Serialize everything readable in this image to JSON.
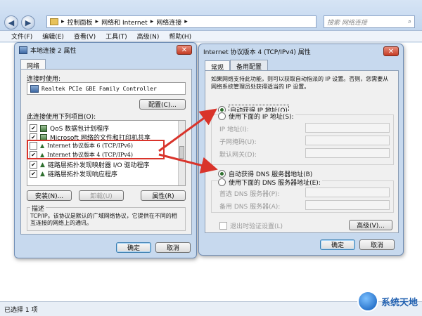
{
  "explorer": {
    "breadcrumb": [
      "控制面板",
      "网络和 Internet",
      "网络连接"
    ],
    "search_placeholder": "搜索 网络连接",
    "menu": [
      "文件(F)",
      "编辑(E)",
      "查看(V)",
      "工具(T)",
      "高级(N)",
      "帮助(H)"
    ],
    "status": "已选择 1 项"
  },
  "props": {
    "title": "本地连接 2 属性",
    "tab": "网络",
    "connect_using_label": "连接时使用:",
    "adapter": "Realtek PCIe GBE Family Controller",
    "configure": "配置(C)...",
    "items_label": "此连接使用下列项目(O):",
    "items": [
      {
        "label": "QoS 数据包计划程序",
        "checked": true
      },
      {
        "label": "Microsoft 网络的文件和打印机共享",
        "checked": true
      },
      {
        "label": "Internet 协议版本 6 (TCP/IPv6)",
        "checked": false
      },
      {
        "label": "Internet 协议版本 4 (TCP/IPv4)",
        "checked": true
      },
      {
        "label": "链路层拓扑发现映射器 I/O 驱动程序",
        "checked": true
      },
      {
        "label": "链路层拓扑发现响应程序",
        "checked": true
      }
    ],
    "install": "安装(N)...",
    "uninstall": "卸载(U)",
    "properties": "属性(R)",
    "desc_title": "描述",
    "desc": "TCP/IP。该协议是默认的广域网络协议，它提供在不同的相互连接的网络上的通讯。",
    "ok": "确定",
    "cancel": "取消"
  },
  "ipv4": {
    "title": "Internet 协议版本 4 (TCP/IPv4) 属性",
    "tabs": [
      "常规",
      "备用配置"
    ],
    "intro": "如果网络支持此功能，则可以获取自动指派的 IP 设置。否则，您需要从网络系统管理员处获得适当的 IP 设置。",
    "auto_ip": "自动获得 IP 地址(O)",
    "manual_ip": "使用下面的 IP 地址(S):",
    "ip_addr": "IP 地址(I):",
    "subnet": "子网掩码(U):",
    "gateway": "默认网关(D):",
    "auto_dns": "自动获得 DNS 服务器地址(B)",
    "manual_dns": "使用下面的 DNS 服务器地址(E):",
    "dns1": "首选 DNS 服务器(P):",
    "dns2": "备用 DNS 服务器(A):",
    "validate": "退出时验证设置(L)",
    "advanced": "高级(V)...",
    "ok": "确定",
    "cancel": "取消"
  },
  "watermark": "系统天地",
  "colors": {
    "highlight_box": "#d9342b",
    "arrow": "#d9342b"
  }
}
